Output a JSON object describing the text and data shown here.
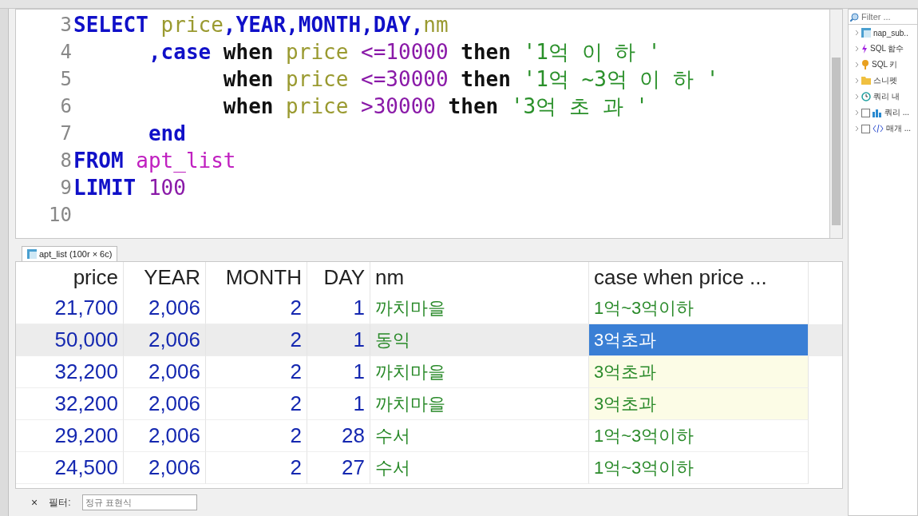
{
  "editor": {
    "lines": [
      {
        "number": "3",
        "tokens": [
          {
            "text": "SELECT ",
            "kind": "keyword"
          },
          {
            "text": "price",
            "kind": "column"
          },
          {
            "text": ",YEAR,MONTH,DAY,",
            "kind": "keyword"
          },
          {
            "text": "nm",
            "kind": "column"
          }
        ]
      },
      {
        "number": "4",
        "tokens": [
          {
            "text": "      ,case",
            "kind": "keyword"
          },
          {
            "text": " when ",
            "kind": "plain"
          },
          {
            "text": "price",
            "kind": "column"
          },
          {
            "text": " <=10000",
            "kind": "number"
          },
          {
            "text": " then ",
            "kind": "plain"
          },
          {
            "text": "'1억 이 하 '",
            "kind": "string"
          }
        ]
      },
      {
        "number": "5",
        "tokens": [
          {
            "text": "            when ",
            "kind": "plain"
          },
          {
            "text": "price",
            "kind": "column"
          },
          {
            "text": " <=30000",
            "kind": "number"
          },
          {
            "text": " then ",
            "kind": "plain"
          },
          {
            "text": "'1억 ~3억 이 하 '",
            "kind": "string"
          }
        ]
      },
      {
        "number": "6",
        "tokens": [
          {
            "text": "            when ",
            "kind": "plain"
          },
          {
            "text": "price",
            "kind": "column"
          },
          {
            "text": " >30000",
            "kind": "number"
          },
          {
            "text": " then ",
            "kind": "plain"
          },
          {
            "text": "'3억 초 과 '",
            "kind": "string"
          }
        ]
      },
      {
        "number": "7",
        "tokens": [
          {
            "text": "      end",
            "kind": "keyword"
          }
        ]
      },
      {
        "number": "8",
        "tokens": [
          {
            "text": "FROM ",
            "kind": "keyword"
          },
          {
            "text": "apt_list",
            "kind": "table"
          }
        ]
      },
      {
        "number": "9",
        "tokens": [
          {
            "text": "LIMIT",
            "kind": "keyword"
          },
          {
            "text": " 100",
            "kind": "number"
          }
        ]
      },
      {
        "number": "10"
      }
    ]
  },
  "sidebar": {
    "filter": {
      "placeholder": "Filter ..."
    },
    "items": [
      {
        "kind": "table",
        "label": "nap_sub.."
      },
      {
        "kind": "function",
        "label": "SQL 함수"
      },
      {
        "kind": "keyword",
        "label": "SQL 키"
      },
      {
        "kind": "snippet",
        "label": "스니펫"
      },
      {
        "kind": "history",
        "label": "쿼리 내"
      },
      {
        "kind": "chart",
        "label": "쿼리 ...",
        "checked": false
      },
      {
        "kind": "parameter",
        "label": "매개 ...",
        "checked": false
      }
    ]
  },
  "result_tab": {
    "label": "apt_list (100r × 6c)"
  },
  "table": {
    "columns": [
      "price",
      "YEAR",
      "MONTH",
      "DAY",
      "nm",
      "case when price ..."
    ],
    "rows": [
      {
        "selected": false,
        "cells": [
          "21,700",
          "2,006",
          "2",
          "1",
          "까치마을",
          "1억~3억이하"
        ],
        "marked": false,
        "focused": false
      },
      {
        "selected": true,
        "cells": [
          "50,000",
          "2,006",
          "2",
          "1",
          "동익",
          "3억초과"
        ],
        "marked": false,
        "focused": true
      },
      {
        "selected": false,
        "cells": [
          "32,200",
          "2,006",
          "2",
          "1",
          "까치마을",
          "3억초과"
        ],
        "marked": true,
        "focused": false
      },
      {
        "selected": false,
        "cells": [
          "32,200",
          "2,006",
          "2",
          "1",
          "까치마을",
          "3억초과"
        ],
        "marked": true,
        "focused": false
      },
      {
        "selected": false,
        "cells": [
          "29,200",
          "2,006",
          "2",
          "28",
          "수서",
          "1억~3억이하"
        ],
        "marked": false,
        "focused": false
      },
      {
        "selected": false,
        "cells": [
          "24,500",
          "2,006",
          "2",
          "27",
          "수서",
          "1억~3억이하"
        ],
        "marked": false,
        "focused": false
      }
    ]
  },
  "filter_bar": {
    "close": "×",
    "label": "필터:",
    "placeholder": "정규 표현식"
  }
}
